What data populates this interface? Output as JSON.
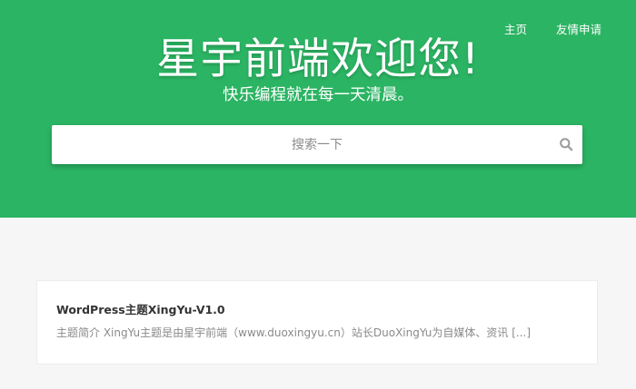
{
  "nav": {
    "items": [
      {
        "label": "主页"
      },
      {
        "label": "友情申请"
      }
    ]
  },
  "hero": {
    "title": "星宇前端欢迎您!",
    "subtitle": "快乐编程就在每一天清晨。",
    "background_color": "#2bb463"
  },
  "search": {
    "placeholder": "搜索一下",
    "icon": "search-icon"
  },
  "posts": [
    {
      "title": "WordPress主题XingYu-V1.0",
      "excerpt": "主题简介 XingYu主题是由星宇前端（www.duoxingyu.cn）站长DuoXingYu为自媒体、资讯 [...]"
    }
  ]
}
